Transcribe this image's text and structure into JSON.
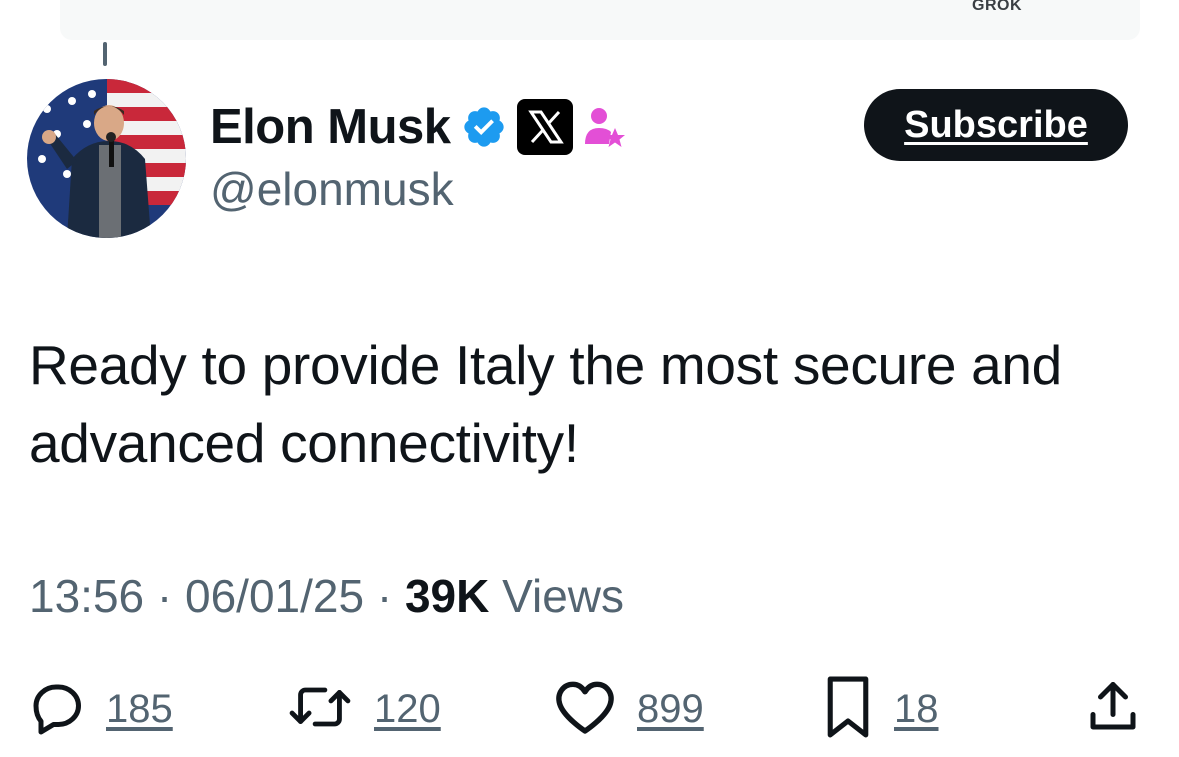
{
  "top_strip": {
    "label": "GROK"
  },
  "author": {
    "display_name": "Elon Musk",
    "handle": "@elonmusk",
    "verified_badge_icon": "verified-badge-icon",
    "affiliation_icon": "x-logo-icon",
    "role_icon": "person-star-icon",
    "colors": {
      "verified": "#1d9bf0",
      "role": "#e34fd6"
    }
  },
  "subscribe_button": {
    "label": "Subscribe"
  },
  "tweet": {
    "text": "Ready to provide Italy the most secure and advanced connectivity!"
  },
  "meta": {
    "time": "13:56",
    "date": "06/01/25",
    "separator": "·",
    "views_count": "39K",
    "views_label": "Views"
  },
  "actions": {
    "replies": {
      "icon": "reply-icon",
      "count": "185"
    },
    "reposts": {
      "icon": "repost-icon",
      "count": "120"
    },
    "likes": {
      "icon": "heart-icon",
      "count": "899"
    },
    "bookmarks": {
      "icon": "bookmark-icon",
      "count": "18"
    },
    "share": {
      "icon": "share-icon"
    }
  }
}
